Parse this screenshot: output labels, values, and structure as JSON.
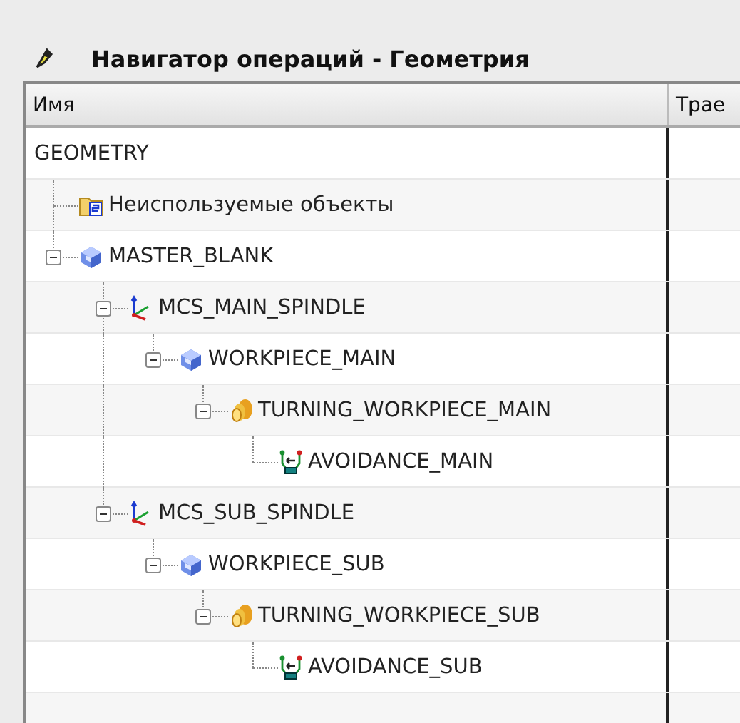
{
  "window": {
    "title": "Навигатор операций - Геометрия"
  },
  "table": {
    "columns": [
      "Имя",
      "Трае"
    ],
    "tree": [
      {
        "name": "GEOMETRY",
        "children": [
          {
            "name": "Неиспользуемые объекты",
            "kind": "folder"
          },
          {
            "name": "MASTER_BLANK",
            "kind": "blank",
            "expanded": true,
            "children": [
              {
                "name": "MCS_MAIN_SPINDLE",
                "kind": "mcs",
                "expanded": true,
                "children": [
                  {
                    "name": "WORKPIECE_MAIN",
                    "kind": "workpiece",
                    "expanded": true,
                    "children": [
                      {
                        "name": "TURNING_WORKPIECE_MAIN",
                        "kind": "turning",
                        "expanded": true,
                        "children": [
                          {
                            "name": "AVOIDANCE_MAIN",
                            "kind": "avoidance"
                          }
                        ]
                      }
                    ]
                  }
                ]
              },
              {
                "name": "MCS_SUB_SPINDLE",
                "kind": "mcs",
                "expanded": true,
                "children": [
                  {
                    "name": "WORKPIECE_SUB",
                    "kind": "workpiece",
                    "expanded": true,
                    "children": [
                      {
                        "name": "TURNING_WORKPIECE_SUB",
                        "kind": "turning",
                        "expanded": true,
                        "children": [
                          {
                            "name": "AVOIDANCE_SUB",
                            "kind": "avoidance"
                          }
                        ]
                      }
                    ]
                  }
                ]
              }
            ]
          }
        ]
      }
    ]
  }
}
